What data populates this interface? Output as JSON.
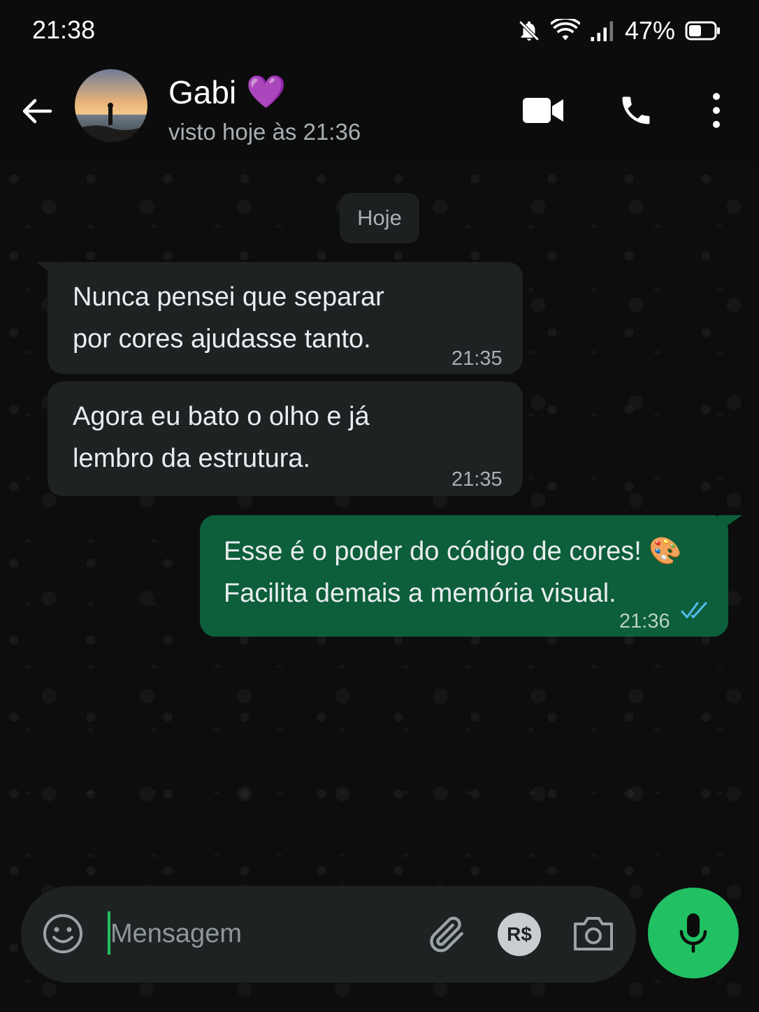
{
  "status_bar": {
    "time": "21:38",
    "battery": "47%"
  },
  "header": {
    "contact_name": "Gabi",
    "contact_emoji": "💜",
    "last_seen": "visto hoje às 21:36"
  },
  "chat": {
    "date_chip": "Hoje",
    "messages": [
      {
        "direction": "incoming",
        "text": "Nunca pensei que separar\npor cores ajudasse tanto.",
        "time": "21:35"
      },
      {
        "direction": "incoming",
        "text": "Agora eu bato o olho e já\nlembro da estrutura.",
        "time": "21:35"
      },
      {
        "direction": "outgoing",
        "text": "Esse é o poder do código de cores! 🎨\nFacilita demais a memória visual.",
        "time": "21:36",
        "status": "read"
      }
    ]
  },
  "input": {
    "placeholder": "Mensagem",
    "pay_label": "R$"
  },
  "colors": {
    "accent": "#21c063",
    "outgoing_bubble": "#0d5e3a",
    "incoming_bubble": "#1f2223",
    "read_ticks": "#53bdeb"
  },
  "icons": [
    "bell-off-icon",
    "wifi-icon",
    "signal-icon",
    "battery-icon",
    "back-arrow-icon",
    "video-call-icon",
    "phone-call-icon",
    "more-options-icon",
    "emoji-icon",
    "attach-icon",
    "payment-icon",
    "camera-icon",
    "mic-icon",
    "read-ticks-icon"
  ]
}
